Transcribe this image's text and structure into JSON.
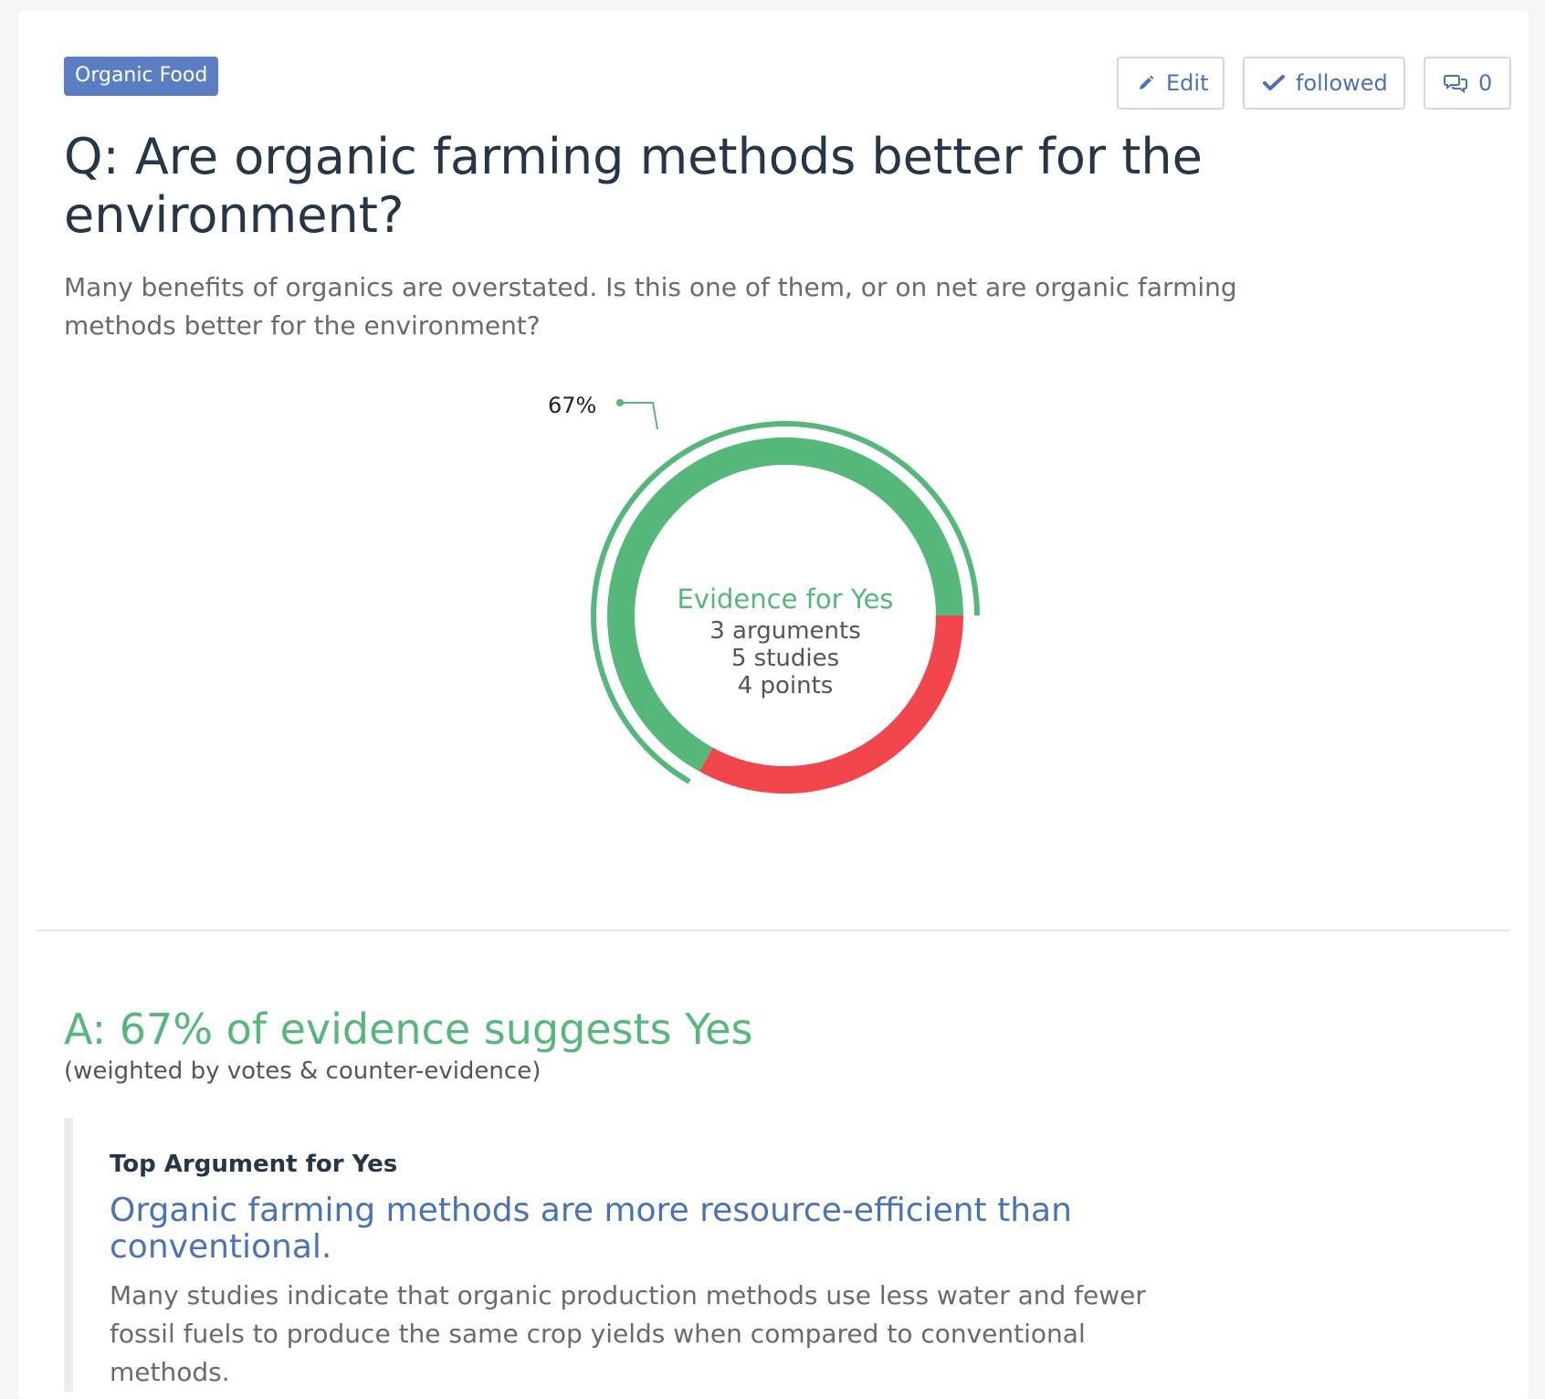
{
  "tag": {
    "label": "Organic Food"
  },
  "toolbar": {
    "edit_label": "Edit",
    "follow_label": "followed",
    "comments_count": "0",
    "icons": {
      "edit": "pencil-icon",
      "follow": "check-icon",
      "comments": "comments-icon"
    }
  },
  "question": {
    "title": "Q: Are organic farming methods better for the environment?",
    "description": "Many benefits of organics are overstated. Is this one of them, or on net are organic farming methods better for the environment?"
  },
  "summary_chart": {
    "percent_label": "67%",
    "center_title": "Evidence for Yes",
    "lines": [
      "3 arguments",
      "5 studies",
      "4 points"
    ]
  },
  "chart_data": {
    "type": "pie",
    "categories": [
      "Yes",
      "No"
    ],
    "values": [
      67,
      33
    ],
    "colors": {
      "Yes": "#55b87a",
      "No": "#f1464b"
    }
  },
  "answer": {
    "headline": "A: 67% of evidence suggests Yes",
    "note": "(weighted by votes & counter-evidence)"
  },
  "top_argument": {
    "label": "Top Argument for Yes",
    "title": "Organic farming methods are more resource-efficient than conventional.",
    "body": "Many studies indicate that organic production methods use less water and fewer fossil fuels to produce the same crop yields when compared to conventional methods."
  }
}
